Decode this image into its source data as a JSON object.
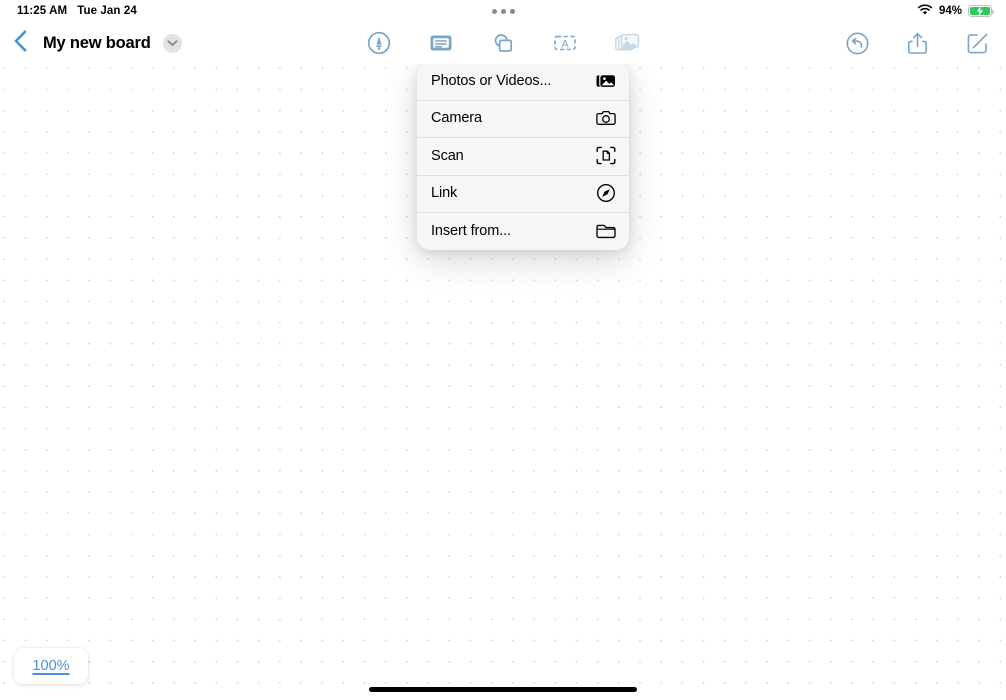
{
  "status_bar": {
    "time": "11:25 AM",
    "date": "Tue Jan 24",
    "battery_percent": "94%",
    "wifi_icon": "wifi-icon",
    "battery_icon": "battery-charging-icon",
    "multitask_icon": "multitasking-dots-icon",
    "battery_color": "#34c759"
  },
  "nav": {
    "back_icon": "chevron-left-icon",
    "title": "My new board",
    "disclosure_icon": "chevron-down-icon",
    "accent_color": "#4a90d9",
    "tool_tint": "#7aa6c6",
    "tools": [
      {
        "name": "markup-tool",
        "icon": "pen-in-circle-icon",
        "active": false
      },
      {
        "name": "sticky-note-tool",
        "icon": "note-icon",
        "active": false
      },
      {
        "name": "shapes-tool",
        "icon": "shapes-icon",
        "active": false
      },
      {
        "name": "text-box-tool",
        "icon": "text-box-icon",
        "active": false
      },
      {
        "name": "media-tool",
        "icon": "media-stack-icon",
        "active": true
      }
    ],
    "right_actions": [
      {
        "name": "undo-button",
        "icon": "undo-arrow-icon"
      },
      {
        "name": "share-button",
        "icon": "share-icon"
      },
      {
        "name": "compose-button",
        "icon": "compose-icon"
      }
    ]
  },
  "media_menu": {
    "items": [
      {
        "label": "Photos or Videos...",
        "icon": "photo-stack-icon"
      },
      {
        "label": "Camera",
        "icon": "camera-icon"
      },
      {
        "label": "Scan",
        "icon": "document-scan-icon"
      },
      {
        "label": "Link",
        "icon": "compass-icon"
      },
      {
        "label": "Insert from...",
        "icon": "folder-icon"
      }
    ]
  },
  "canvas": {
    "zoom_level": "100%",
    "grid_style": "dot-grid",
    "background_color": "#ffffff",
    "dot_color": "#d3d3d6"
  }
}
